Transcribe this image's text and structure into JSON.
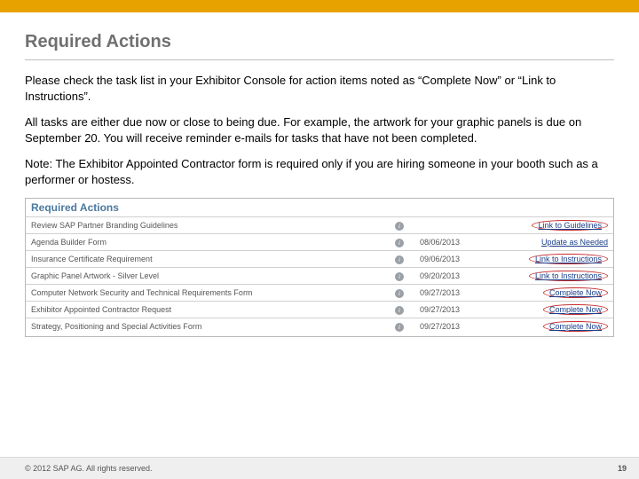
{
  "title": "Required Actions",
  "paragraphs": {
    "p1": "Please check the task list in your Exhibitor Console for action items noted as “Complete Now” or “Link to Instructions”.",
    "p2": "All tasks are either due now or close to being due. For example, the artwork for your graphic panels is due on September 20.  You will receive reminder e-mails for tasks that have not been completed.",
    "p3": "Note: The Exhibitor Appointed Contractor form is required only if you are hiring someone in your booth such as a performer or hostess."
  },
  "screenshot": {
    "heading": "Required Actions",
    "rows": [
      {
        "name": "Review SAP Partner Branding Guidelines",
        "date": "",
        "link": "Link to Guidelines",
        "circled": true
      },
      {
        "name": "Agenda Builder Form",
        "date": "08/06/2013",
        "link": "Update as Needed",
        "circled": false
      },
      {
        "name": "Insurance Certificate Requirement",
        "date": "09/06/2013",
        "link": "Link to Instructions",
        "circled": true
      },
      {
        "name": "Graphic Panel Artwork - Silver Level",
        "date": "09/20/2013",
        "link": "Link to Instructions",
        "circled": true
      },
      {
        "name": "Computer Network Security and Technical Requirements Form",
        "date": "09/27/2013",
        "link": "Complete Now",
        "circled": true
      },
      {
        "name": "Exhibitor Appointed Contractor Request",
        "date": "09/27/2013",
        "link": "Complete Now",
        "circled": true
      },
      {
        "name": "Strategy, Positioning and Special Activities Form",
        "date": "09/27/2013",
        "link": "Complete Now",
        "circled": true
      }
    ]
  },
  "footer": {
    "copyright": "©  2012 SAP AG. All rights reserved.",
    "page": "19"
  }
}
